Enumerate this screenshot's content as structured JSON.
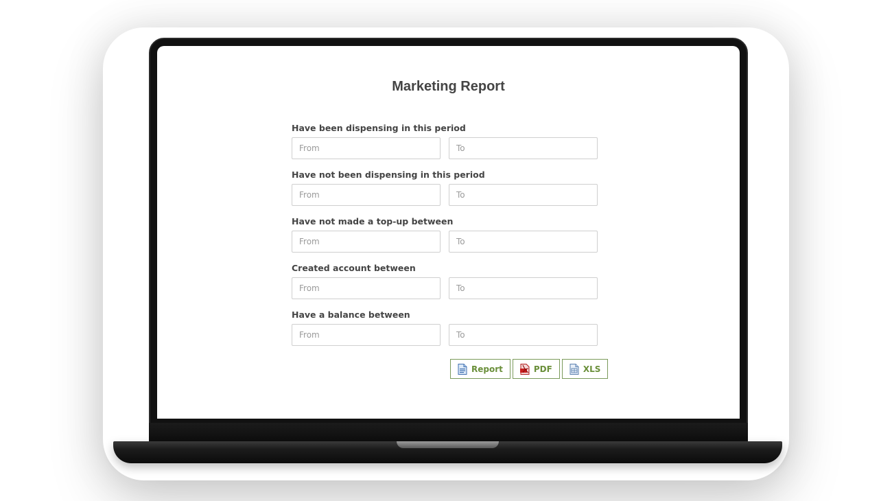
{
  "page": {
    "title": "Marketing Report"
  },
  "filters": [
    {
      "label": "Have been dispensing in this period",
      "from_placeholder": "From",
      "to_placeholder": "To"
    },
    {
      "label": "Have not been dispensing in this period",
      "from_placeholder": "From",
      "to_placeholder": "To"
    },
    {
      "label": "Have not made a top-up between",
      "from_placeholder": "From",
      "to_placeholder": "To"
    },
    {
      "label": "Created account between",
      "from_placeholder": "From",
      "to_placeholder": "To"
    },
    {
      "label": "Have a balance between",
      "from_placeholder": "From",
      "to_placeholder": "To"
    }
  ],
  "actions": {
    "report": {
      "label": "Report",
      "icon": "document-icon"
    },
    "pdf": {
      "label": "PDF",
      "icon": "pdf-icon"
    },
    "xls": {
      "label": "XLS",
      "icon": "spreadsheet-icon"
    }
  },
  "colors": {
    "button_text": "#6a8f3a",
    "button_border": "#7a9a5a",
    "title_text": "#444444"
  }
}
